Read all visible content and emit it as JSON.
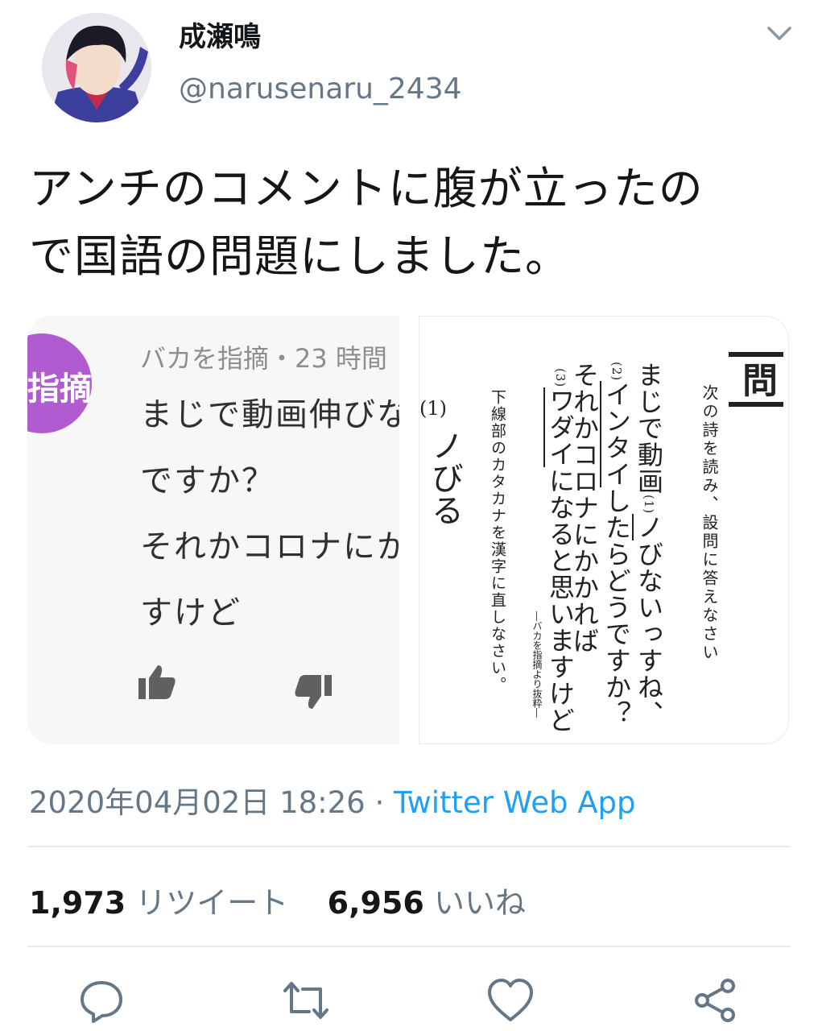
{
  "user": {
    "display_name": "成瀬鳴",
    "handle": "@narusenaru_2434"
  },
  "tweet": {
    "text_line1": "アンチのコメントに腹が立ったの",
    "text_line2": "で国語の問題にしました。"
  },
  "media": {
    "left": {
      "badge_text": "指摘",
      "meta": "バカを指摘・23 時間",
      "lines": [
        "まじで動画伸びな",
        "ですか？",
        "それかコロナにか",
        "すけど"
      ],
      "icons": [
        "thumbs-up-icon",
        "thumbs-down-icon"
      ]
    },
    "right": {
      "heading": "問",
      "instruction": "次の詩を読み、設問に答えなさい",
      "poem": {
        "line1_a": "まじで動画",
        "line1_mark": "(1)",
        "line1_u": "ノ",
        "line1_b": "びないっすね、",
        "line2_mark": "(2)",
        "line2_u": "インタイ",
        "line2_b": "したらどうですか？",
        "line3_a": "それかコロナにかかれば",
        "line3_mark": "(3)",
        "line3_u": "ワダイ",
        "line3_b": "になると思いますけど"
      },
      "source": "―バカを指摘より抜粋―",
      "question": "下線部のカタカナを漢字に直しなさい。",
      "answer_num": "(1)",
      "answer": "ノびる"
    }
  },
  "meta": {
    "timestamp": "2020年04月02日 18:26",
    "separator": " · ",
    "source": "Twitter Web App"
  },
  "stats": {
    "retweets": "1,973",
    "retweets_label": "リツイート",
    "likes": "6,956",
    "likes_label": "いいね"
  },
  "actions": [
    "reply-icon",
    "retweet-icon",
    "like-icon",
    "share-icon"
  ],
  "colors": {
    "link": "#1da1f2",
    "secondary": "#657786",
    "badge": "#b15bd1"
  }
}
